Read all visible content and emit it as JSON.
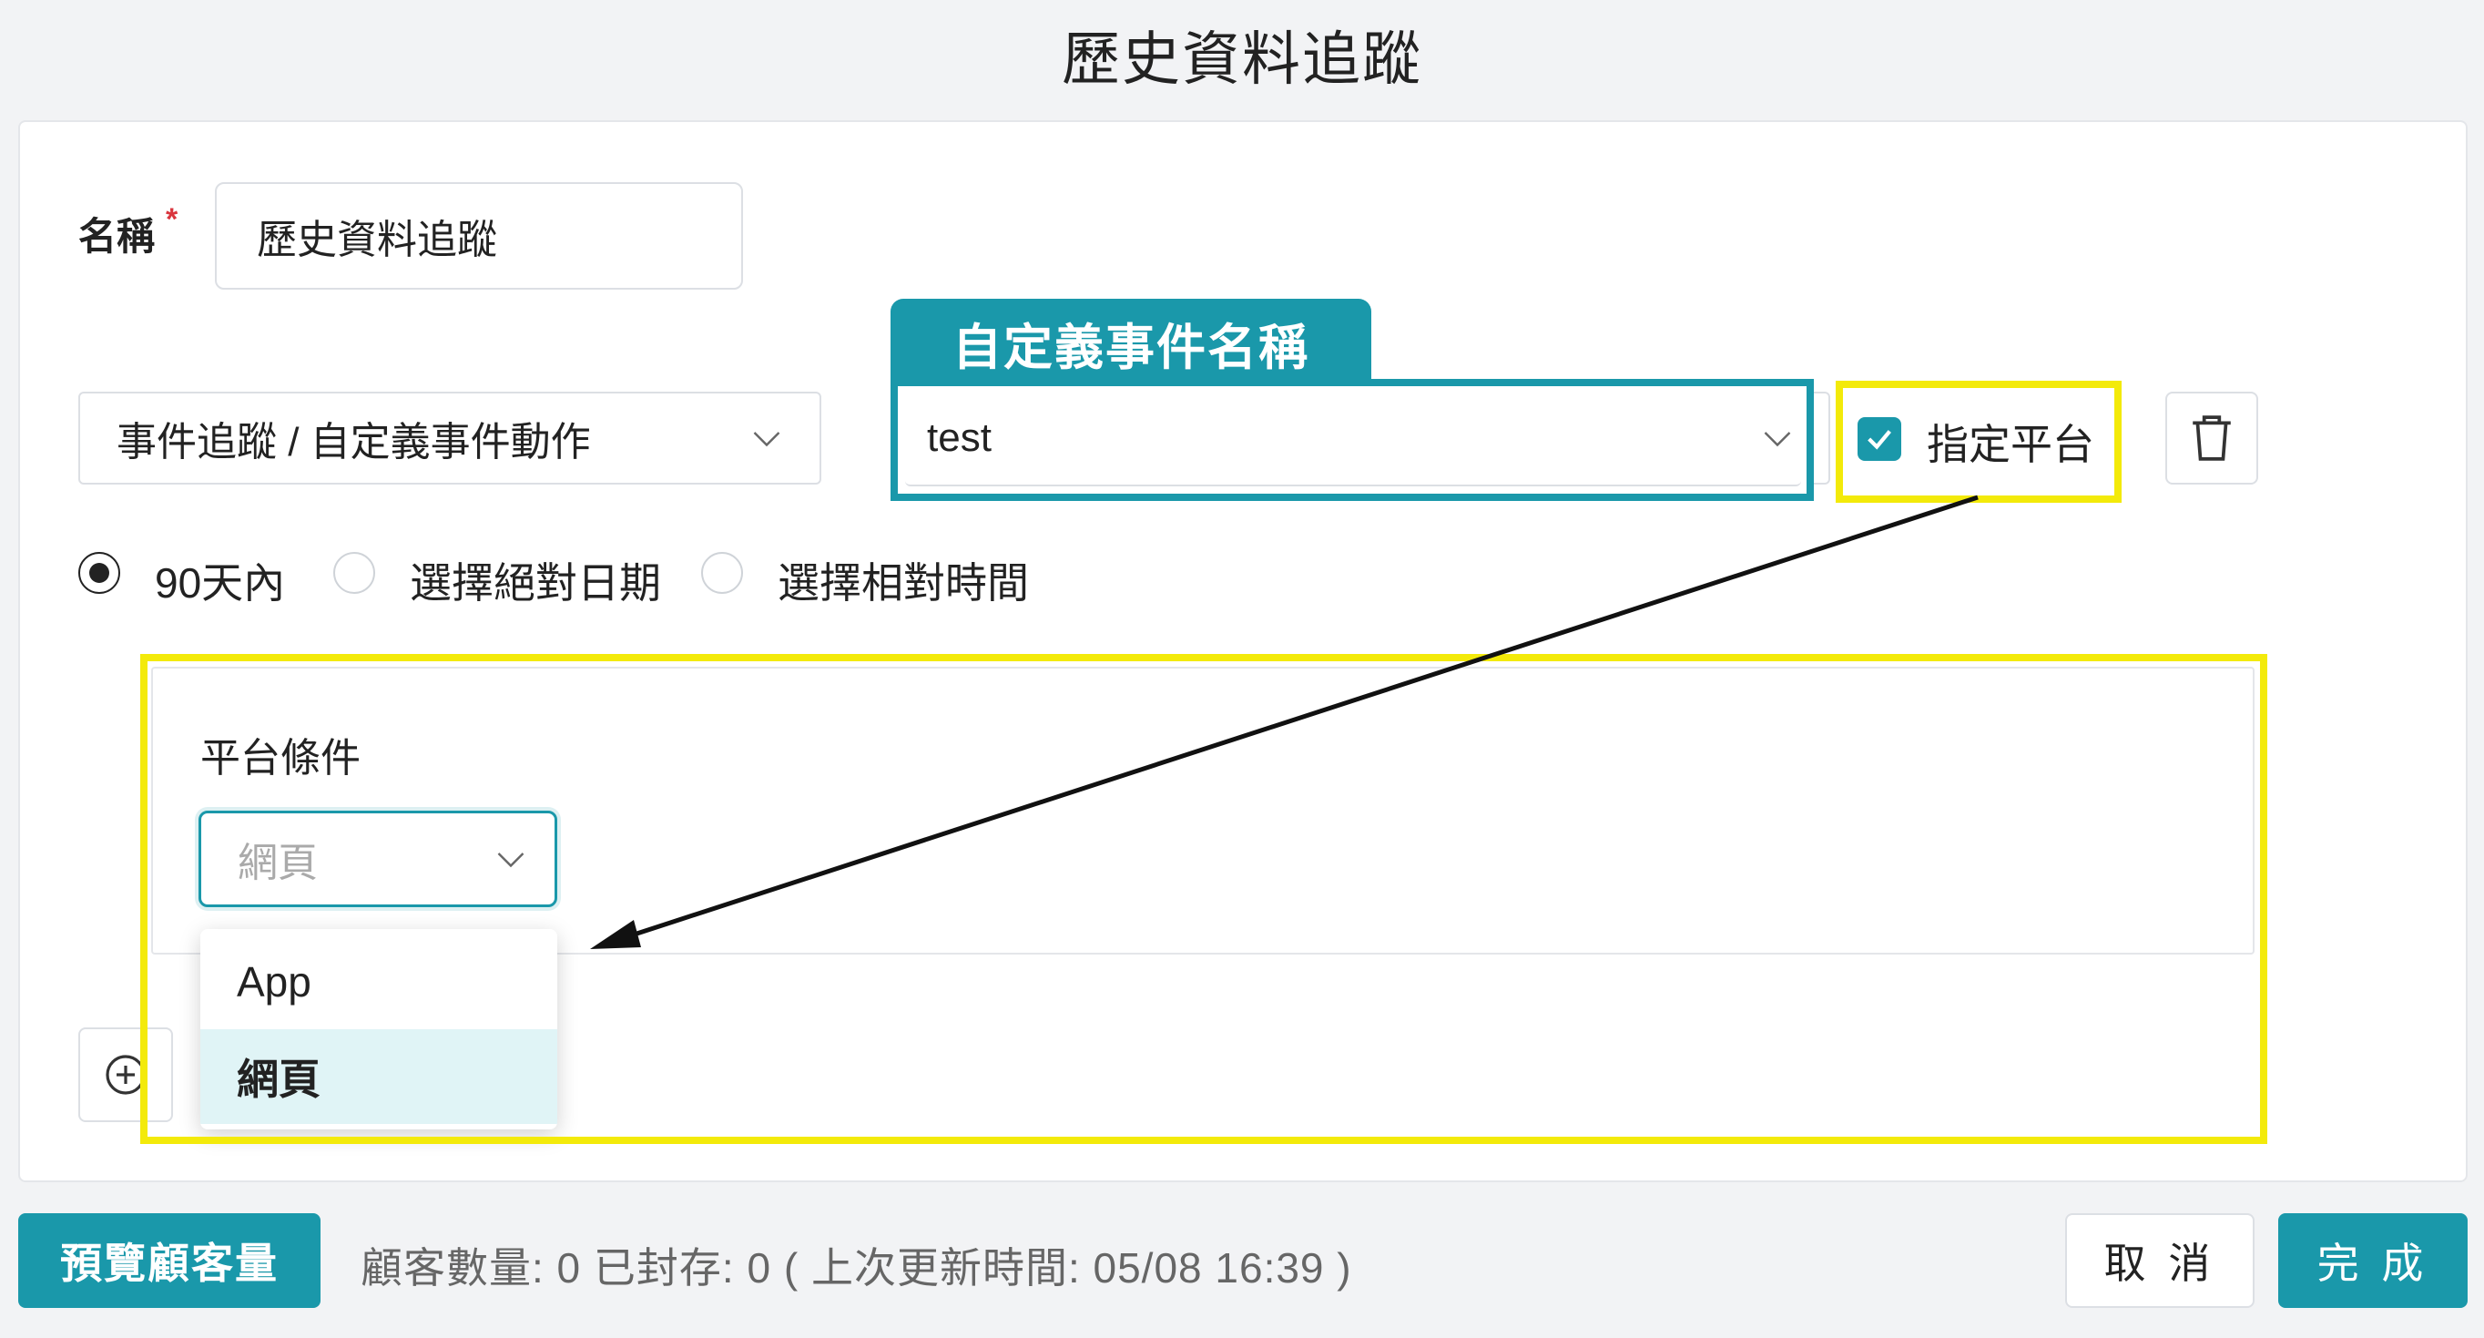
{
  "page": {
    "title": "歷史資料追蹤"
  },
  "form": {
    "name_label": "名稱",
    "required_mark": "*",
    "name_value": "歷史資料追蹤",
    "event_type_value": "事件追蹤 / 自定義事件動作",
    "event_name_value": "test",
    "platform_checkbox_label": "指定平台",
    "platform_checked": true,
    "time_options": [
      {
        "label": "90天內",
        "selected": true
      },
      {
        "label": "選擇絕對日期",
        "selected": false
      },
      {
        "label": "選擇相對時間",
        "selected": false
      }
    ]
  },
  "annotations": {
    "event_name_tag": "自定義事件名稱",
    "highlight_color": "#f3ea0a",
    "tag_color": "#1a98aa"
  },
  "platform_panel": {
    "title": "平台條件",
    "selected_value": "網頁",
    "options": [
      {
        "label": "App",
        "selected": false
      },
      {
        "label": "網頁",
        "selected": true
      }
    ]
  },
  "footer": {
    "preview_button": "預覽顧客量",
    "status": "顧客數量: 0  已封存: 0  (  上次更新時間: 05/08 16:39  )",
    "cancel_button": "取 消",
    "done_button": "完 成"
  },
  "icons": {
    "chevron": "chevron-down-icon",
    "trash": "trash-icon",
    "add": "plus-circle-icon",
    "check": "check-icon"
  },
  "colors": {
    "accent": "#1a98aa",
    "background": "#f2f3f5",
    "required": "#d9363e"
  }
}
